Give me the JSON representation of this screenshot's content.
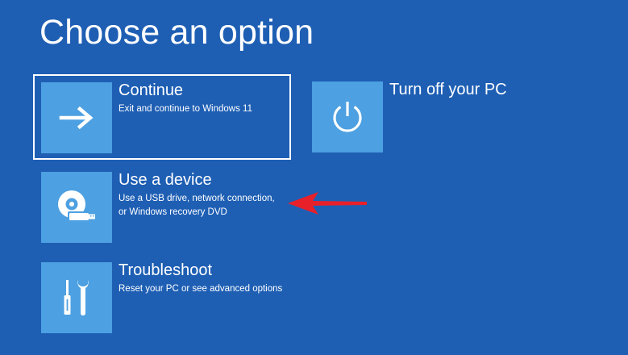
{
  "page": {
    "title": "Choose an option",
    "background_color": "#1e5fb4",
    "tile_color": "#4da0e1"
  },
  "options": {
    "continue": {
      "title": "Continue",
      "desc_lines": [
        "Exit and continue to Windows 11"
      ],
      "icon": "arrow-right-icon",
      "selected": true
    },
    "turn_off": {
      "title": "Turn off your PC",
      "desc_lines": [],
      "icon": "power-icon"
    },
    "use_device": {
      "title": "Use a device",
      "desc_lines": [
        "Use a USB drive, network connection,",
        "or Windows recovery DVD"
      ],
      "icon": "disc-usb-icon"
    },
    "troubleshoot": {
      "title": "Troubleshoot",
      "desc_lines": [
        "Reset your PC or see advanced options"
      ],
      "icon": "tools-icon"
    }
  },
  "annotation": {
    "icon": "red-arrow-icon",
    "color": "#e8202a"
  }
}
